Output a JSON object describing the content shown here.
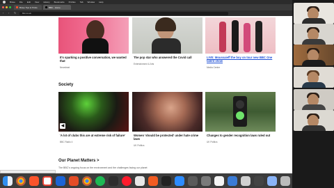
{
  "menubar": {
    "app": "Brave",
    "items": [
      "File",
      "Edit",
      "View",
      "History",
      "Bookmarks",
      "Profiles",
      "Tab",
      "Window",
      "Help"
    ]
  },
  "tabs": [
    {
      "label": "Brave Tips & Tricks"
    },
    {
      "label": "BBC - Home"
    }
  ],
  "address": {
    "url": "bbc.co.uk"
  },
  "top_cards": [
    {
      "title": "It's sparking a positive conversation, we wanted that",
      "tag": "Newsbeat"
    },
    {
      "title": "The pop star who answered the Covid call",
      "tag": "Entertainment & Arts"
    },
    {
      "title": "LIVE: Moussaieff the boy on tour new BBC One talent show",
      "tag": "Media Centre"
    }
  ],
  "society": {
    "heading": "Society",
    "cards": [
      {
        "title": "'A lot of clubs this are at extreme risk of failure'",
        "tag": "BBC Radio 4"
      },
      {
        "title": "Women 'should be protected' under hate crime laws",
        "tag": "UK Politics"
      },
      {
        "title": "Changes to gender recognition laws ruled out",
        "tag": "UK Politics"
      }
    ]
  },
  "planet": {
    "heading": "Our Planet Matters >",
    "subtext": "The BBC's ongoing focus on the environment and the challenges facing our planet"
  },
  "statusbar": {
    "text": "https://www.bbc.co.uk/news"
  },
  "colors": {
    "page_bg": "#ffffff",
    "link": "#1d4fd6",
    "dock_bg": "#3c3c3c"
  },
  "dock_icons": [
    "finder-icon",
    "chrome-icon",
    "brave-icon",
    "gmail-icon",
    "app-icon",
    "app-icon",
    "chrome-icon",
    "spotify-icon",
    "app-icon",
    "opera-icon",
    "app-icon",
    "app-icon",
    "app-icon",
    "zoom-icon",
    "app-icon",
    "app-icon",
    "app-icon",
    "app-icon",
    "app-icon",
    "app-icon",
    "app-icon",
    "app-icon",
    "trash-icon"
  ],
  "video_participants": 5
}
